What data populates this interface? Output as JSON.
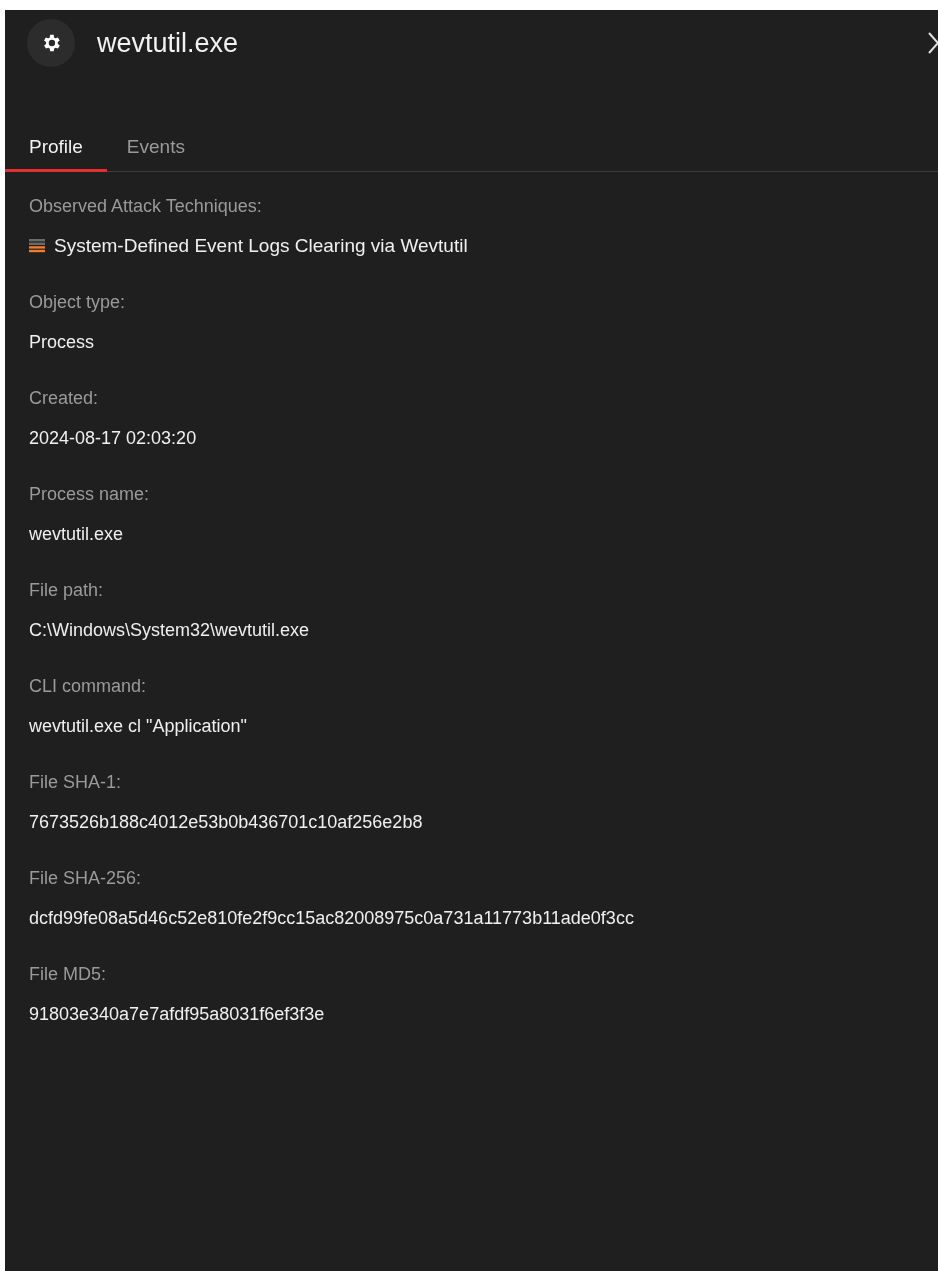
{
  "header": {
    "title": "wevtutil.exe"
  },
  "tabs": [
    {
      "label": "Profile",
      "selected": true
    },
    {
      "label": "Events",
      "selected": false
    }
  ],
  "techniques": {
    "label": "Observed Attack Techniques:",
    "items": [
      {
        "name": "System-Defined Event Logs Clearing via Wevtutil",
        "level": 0.5
      }
    ]
  },
  "fields": [
    {
      "label": "Object type:",
      "value": "Process"
    },
    {
      "label": "Created:",
      "value": "2024-08-17 02:03:20"
    },
    {
      "label": "Process name:",
      "value": "wevtutil.exe"
    },
    {
      "label": "File path:",
      "value": "C:\\Windows\\System32\\wevtutil.exe"
    },
    {
      "label": "CLI command:",
      "value": "wevtutil.exe cl \"Application\""
    },
    {
      "label": "File SHA-1:",
      "value": "7673526b188c4012e53b0b436701c10af256e2b8"
    },
    {
      "label": "File SHA-256:",
      "value": "dcfd99fe08a5d46c52e810fe2f9cc15ac82008975c0a731a11773b11ade0f3cc"
    },
    {
      "label": "File MD5:",
      "value": "91803e340a7e7afdf95a8031f6ef3f3e"
    }
  ]
}
